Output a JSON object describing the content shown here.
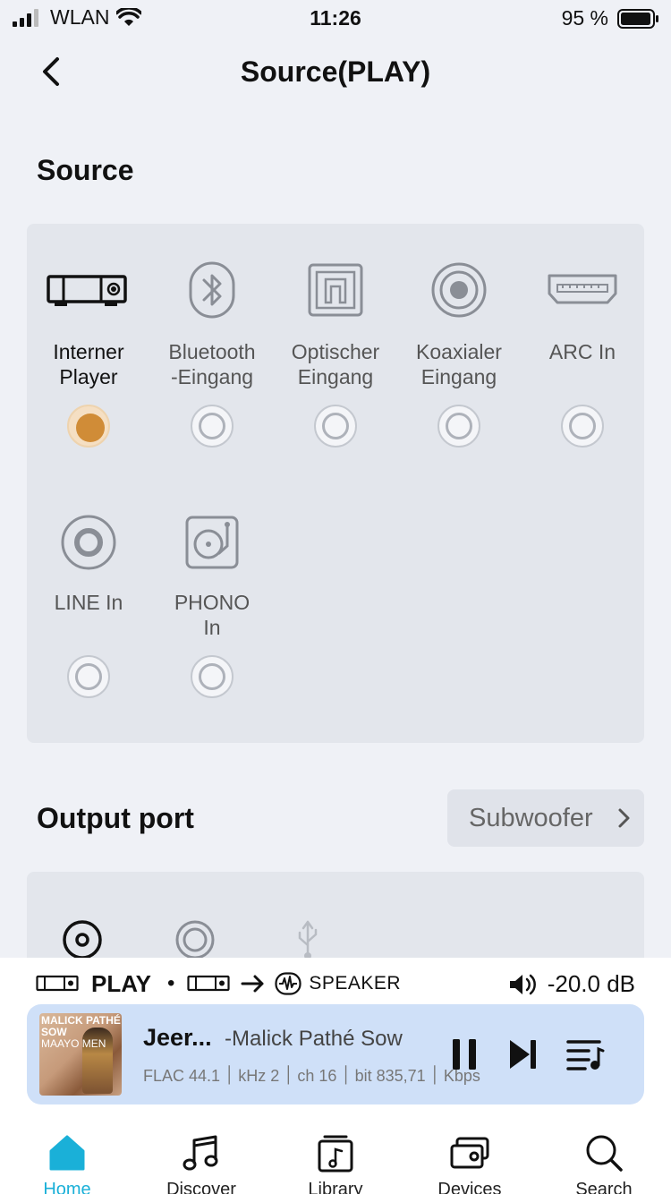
{
  "status_bar": {
    "carrier": "WLAN",
    "time": "11:26",
    "battery": "95 %"
  },
  "header": {
    "title": "Source(PLAY)"
  },
  "source_section": {
    "title": "Source",
    "items": [
      {
        "label_line1": "Interner",
        "label_line2": "Player",
        "icon": "device-player-icon",
        "selected": true
      },
      {
        "label_line1": "Bluetooth",
        "label_line2": "-Eingang",
        "icon": "bluetooth-icon",
        "selected": false
      },
      {
        "label_line1": "Optischer",
        "label_line2": "Eingang",
        "icon": "optical-port-icon",
        "selected": false
      },
      {
        "label_line1": "Koaxialer",
        "label_line2": "Eingang",
        "icon": "coaxial-port-icon",
        "selected": false
      },
      {
        "label_line1": "ARC In",
        "label_line2": "",
        "icon": "hdmi-arc-icon",
        "selected": false
      },
      {
        "label_line1": "LINE In",
        "label_line2": "",
        "icon": "line-in-icon",
        "selected": false
      },
      {
        "label_line1": "PHONO",
        "label_line2": "In",
        "icon": "turntable-icon",
        "selected": false
      }
    ]
  },
  "output_section": {
    "title": "Output port",
    "button_label": "Subwoofer"
  },
  "player": {
    "route_source": "PLAY",
    "route_target": "SPEAKER",
    "volume": "-20.0 dB",
    "album_art_text": "MALICK PATHÉ SOW",
    "album_art_subtext": "MAAYO MEN",
    "track_title": "Jeer...",
    "track_artist": "-Malick Pathé Sow",
    "format": "FLAC",
    "sample_rate": "44.1 kHz",
    "channels": "2 ch",
    "bit_depth": "16 bit",
    "bitrate": "835,71 Kbps",
    "accent_color": "#d08c37"
  },
  "tabs": [
    {
      "label": "Home",
      "icon": "home-icon",
      "active": true
    },
    {
      "label": "Discover",
      "icon": "music-note-icon",
      "active": false
    },
    {
      "label": "Library",
      "icon": "library-icon",
      "active": false
    },
    {
      "label": "Devices",
      "icon": "devices-icon",
      "active": false
    },
    {
      "label": "Search",
      "icon": "search-icon",
      "active": false
    }
  ],
  "colors": {
    "active_tab": "#1ab0d8",
    "now_playing_bg": "#cfe0f8",
    "selected_radio": "#d08c37"
  }
}
